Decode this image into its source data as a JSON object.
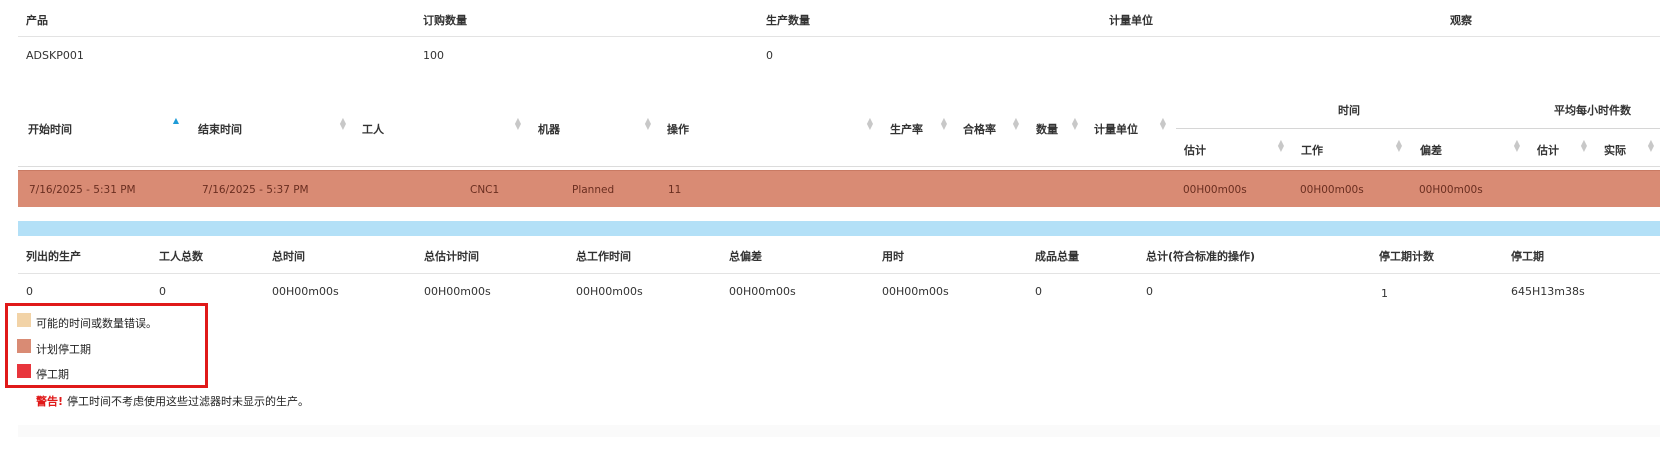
{
  "summary_top": {
    "headers": {
      "product": "产品",
      "order_qty": "订购数量",
      "produced_qty": "生产数量",
      "unit": "计量单位",
      "observe": "观察"
    },
    "row": {
      "product": "ADSKP001",
      "order_qty": "100",
      "produced_qty": "0",
      "unit": "",
      "observe": ""
    }
  },
  "production_table": {
    "headers": {
      "start_time": "开始时间",
      "end_time": "结束时间",
      "worker": "工人",
      "machine": "机器",
      "operation": "操作",
      "rate": "生产率",
      "yield": "合格率",
      "quantity": "数量",
      "unit": "计量单位",
      "time_group": "时间",
      "avg_group": "平均每小时件数",
      "time_est": "估计",
      "time_work": "工作",
      "time_dev": "偏差",
      "avg_est": "估计",
      "avg_actual": "实际"
    },
    "rows": [
      {
        "start_time": "7/16/2025 - 5:31 PM",
        "end_time": "7/16/2025 - 5:37 PM",
        "worker": "CNC1",
        "machine": "Planned",
        "operation": "11",
        "time_est": "00H00m00s",
        "time_work": "00H00m00s",
        "time_dev": "00H00m00s",
        "status_color": "#d98b74"
      }
    ]
  },
  "totals": {
    "headers": {
      "listed": "列出的生产",
      "workers": "工人总数",
      "total_time": "总时间",
      "total_est": "总估计时间",
      "total_work": "总工作时间",
      "total_dev": "总偏差",
      "elapsed": "用时",
      "finished": "成品总量",
      "total_std": "总计(符合标准的操作)",
      "downtime_count": "停工期计数",
      "downtime": "停工期"
    },
    "row": {
      "listed": "0",
      "workers": "0",
      "total_time": "00H00m00s",
      "total_est": "00H00m00s",
      "total_work": "00H00m00s",
      "total_dev": "00H00m00s",
      "elapsed": "00H00m00s",
      "finished": "0",
      "total_std": "0",
      "downtime_count": "1",
      "downtime": "645H13m38s"
    }
  },
  "legend": {
    "items": [
      {
        "label": "可能的时间或数量错误。",
        "color": "#f2d3a7"
      },
      {
        "label": "计划停工期",
        "color": "#d98b74"
      },
      {
        "label": "停工期",
        "color": "#e8353c"
      }
    ],
    "highlight_color": "#e01919"
  },
  "warning": {
    "label": "警告!",
    "text": "停工时间不考虑使用这些过滤器时未显示的生产。"
  },
  "colors": {
    "accent_blue": "#1e9bd7",
    "blue_bar": "#b3e0f7"
  }
}
